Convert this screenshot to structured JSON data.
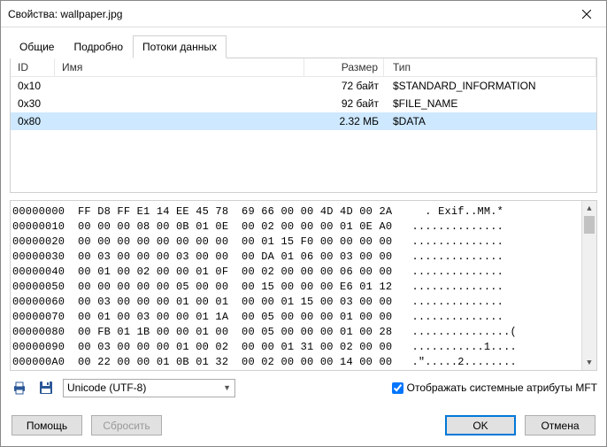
{
  "window": {
    "title": "Свойства: wallpaper.jpg"
  },
  "tabs": {
    "t0": "Общие",
    "t1": "Подробно",
    "t2": "Потоки данных"
  },
  "table": {
    "headers": {
      "id": "ID",
      "name": "Имя",
      "size": "Размер",
      "type": "Тип"
    },
    "rows": [
      {
        "id": "0x10",
        "name": "",
        "size": "72 байт",
        "type": "$STANDARD_INFORMATION"
      },
      {
        "id": "0x30",
        "name": "",
        "size": "92 байт",
        "type": "$FILE_NAME"
      },
      {
        "id": "0x80",
        "name": "",
        "size": "2.32 МБ",
        "type": "$DATA"
      }
    ]
  },
  "hex": {
    "lines": [
      "00000000  FF D8 FF E1 14 EE 45 78  69 66 00 00 4D 4D 00 2A     . Exif..MM.*",
      "00000010  00 00 00 08 00 0B 01 0E  00 02 00 00 00 01 0E A0   ..............",
      "00000020  00 00 00 00 00 00 00 00  00 01 15 F0 00 00 00 00   ..............",
      "00000030  00 03 00 00 00 03 00 00  00 DA 01 06 00 03 00 00   ..............",
      "00000040  00 01 00 02 00 00 01 0F  00 02 00 00 00 06 00 00   ..............",
      "00000050  00 00 00 00 00 05 00 00  00 15 00 00 00 E6 01 12   ..............",
      "00000060  00 03 00 00 00 01 00 01  00 00 01 15 00 03 00 00   ..............",
      "00000070  00 01 00 03 00 00 01 1A  00 05 00 00 00 01 00 00   ..............",
      "00000080  00 FB 01 1B 00 00 01 00  00 05 00 00 00 01 00 28   ...............(",
      "00000090  00 03 00 00 00 01 00 02  00 00 01 31 00 02 00 00   ...........1....",
      "000000A0  00 22 00 00 01 0B 01 32  00 02 00 00 00 14 00 00   .\".....2........"
    ]
  },
  "toolbar": {
    "encoding": "Unicode (UTF-8)",
    "mft_checkbox_label": "Отображать системные атрибуты MFT"
  },
  "footer": {
    "help": "Помощь",
    "reset": "Сбросить",
    "ok": "OK",
    "cancel": "Отмена"
  }
}
